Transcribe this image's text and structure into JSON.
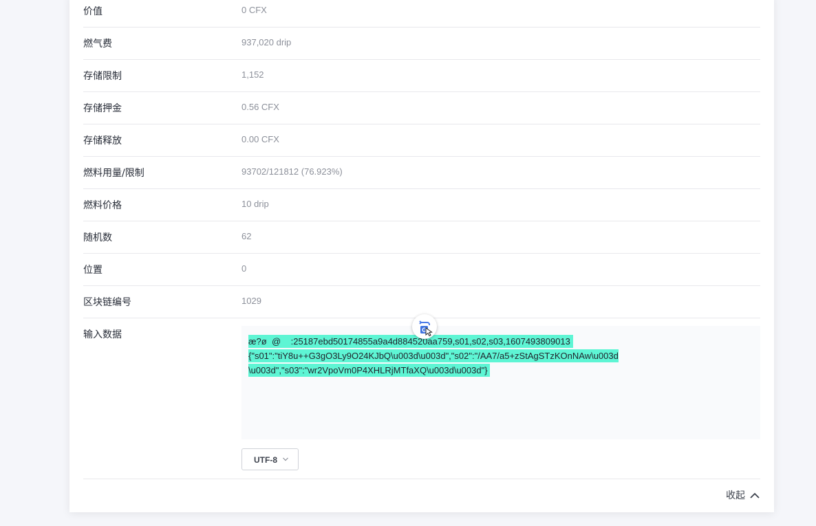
{
  "details": {
    "rows": [
      {
        "label": "价值",
        "value": "0 CFX"
      },
      {
        "label": "燃气费",
        "value": "937,020 drip"
      },
      {
        "label": "存储限制",
        "value": "1,152"
      },
      {
        "label": "存储押金",
        "value": "0.56 CFX"
      },
      {
        "label": "存储释放",
        "value": "0.00 CFX"
      },
      {
        "label": "燃料用量/限制",
        "value": "93702/121812 (76.923%)"
      },
      {
        "label": "燃料价格",
        "value": "10 drip"
      },
      {
        "label": "随机数",
        "value": "62"
      },
      {
        "label": "位置",
        "value": "0"
      },
      {
        "label": "区块链编号",
        "value": "1029"
      }
    ]
  },
  "input_data": {
    "label": "输入数据",
    "lines": [
      "æ?ø  @    :25187ebd50174855a9a4d884520aa759,s01,s02,s03,1607493809013 ",
      "{\"s01\":\"tiY8u++G3gO3Ly9O24KJbQ\\u003d\\u003d\",\"s02\":\"/AA7/a5+zStAgSTzKOnNAw\\u003d",
      "\\u003d\",\"s03\":\"wr2VpoVm0P4XHLRjMTfaXQ\\u003d\\u003d\"} "
    ],
    "encoding": "UTF-8"
  },
  "collapse": {
    "label": "收起"
  },
  "colors": {
    "highlight": "#5ef5d4",
    "label": "#282d38",
    "value": "#8b8f99"
  }
}
